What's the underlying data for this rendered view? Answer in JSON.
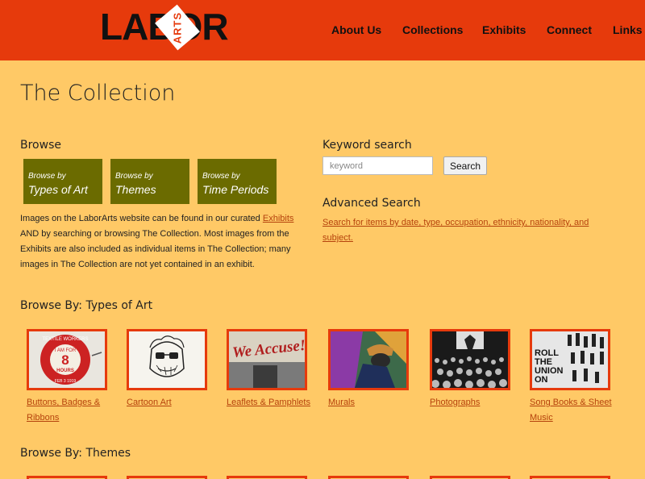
{
  "header": {
    "logo": {
      "main": "LABOR",
      "badge": "ARTS"
    },
    "nav": [
      "About Us",
      "Collections",
      "Exhibits",
      "Connect",
      "Links"
    ]
  },
  "page_title": "The Collection",
  "browse": {
    "heading": "Browse",
    "buttons": [
      {
        "small": "Browse by",
        "big": "Types of Art"
      },
      {
        "small": "Browse by",
        "big": "Themes"
      },
      {
        "small": "Browse by",
        "big": "Time Periods"
      }
    ],
    "text_before": "Images on the LaborArts website can be found in our curated ",
    "text_link": "Exhibits",
    "text_after": " AND by searching or browsing The Collection. Most images from the Exhibits are also included as individual items in The Collection; many images in The Collection are not yet contained in an exhibit."
  },
  "search": {
    "heading": "Keyword search",
    "placeholder": "keyword",
    "button": "Search",
    "advanced_heading": "Advanced Search",
    "advanced_link": "Search for items by date, type, occupation, ethnicity, nationality, and subject."
  },
  "types_section": {
    "heading": "Browse By: Types of Art",
    "items": [
      {
        "label": "Buttons, Badges & Ribbons",
        "icon": "button-badge-thumbnail"
      },
      {
        "label": "Cartoon Art",
        "icon": "cartoon-face-thumbnail"
      },
      {
        "label": "Leaflets & Pamphlets",
        "icon": "we-accuse-leaflet-thumbnail"
      },
      {
        "label": "Murals",
        "icon": "mural-thumbnail"
      },
      {
        "label": "Photographs",
        "icon": "crowd-photo-thumbnail"
      },
      {
        "label": "Song Books & Sheet Music",
        "icon": "roll-the-union-on-thumbnail"
      }
    ]
  },
  "themes_section": {
    "heading": "Browse By: Themes"
  },
  "button_badge_text": {
    "arc": "TEXTILE WORKERS",
    "center1": "I AM FOR",
    "center2": "8",
    "center3": "HOURS",
    "bottom": "FEB 3 1919"
  },
  "leaflet_text": "We Accuse!",
  "song_text": [
    "ROLL",
    "THE",
    "UNION",
    "ON"
  ],
  "colors": {
    "header": "#e63a0c",
    "background": "#ffc966",
    "browse_button": "#6b6b00",
    "link": "#b5420c"
  }
}
